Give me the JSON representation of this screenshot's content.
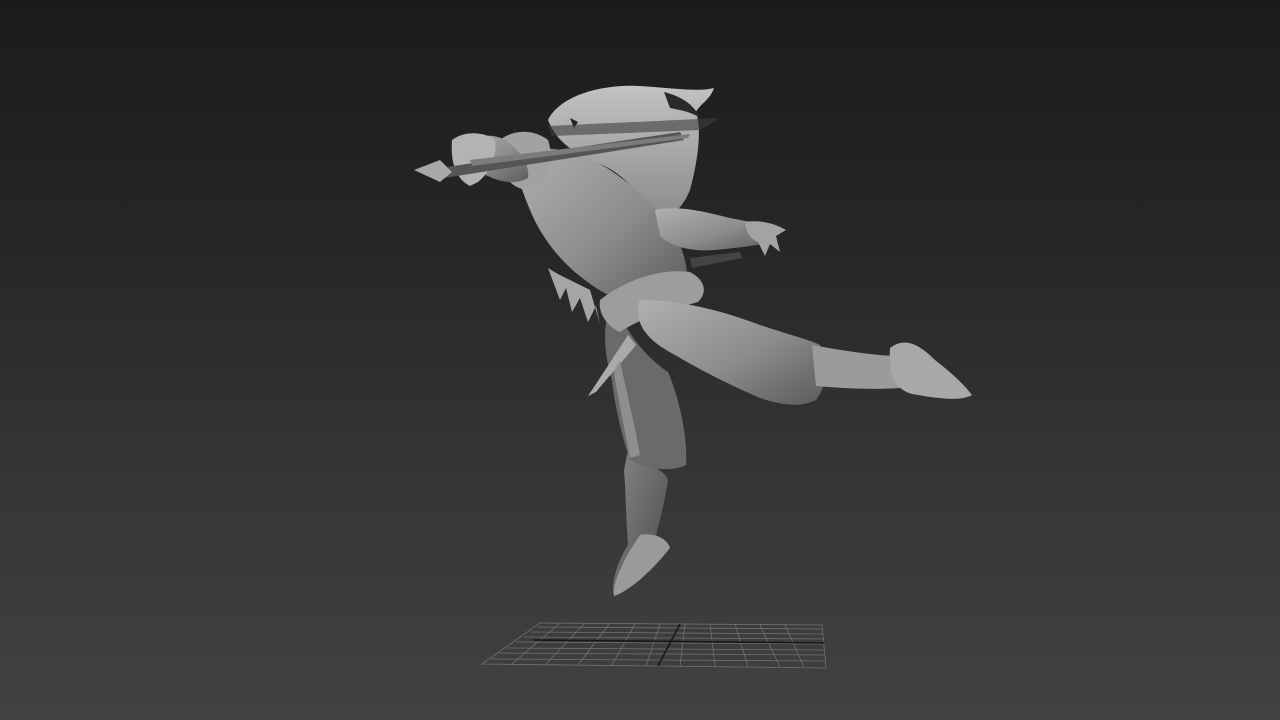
{
  "viewport": {
    "background_top": "#1b1b1b",
    "background_bottom": "#424242"
  },
  "scene": {
    "character": {
      "shading": "gray-clay",
      "base_color": "#8e8e8e",
      "shadow_color": "#4a4a4a",
      "highlight_color": "#b4b4b4"
    },
    "home_grid": {
      "line_color": "#7a7a7a"
    }
  }
}
